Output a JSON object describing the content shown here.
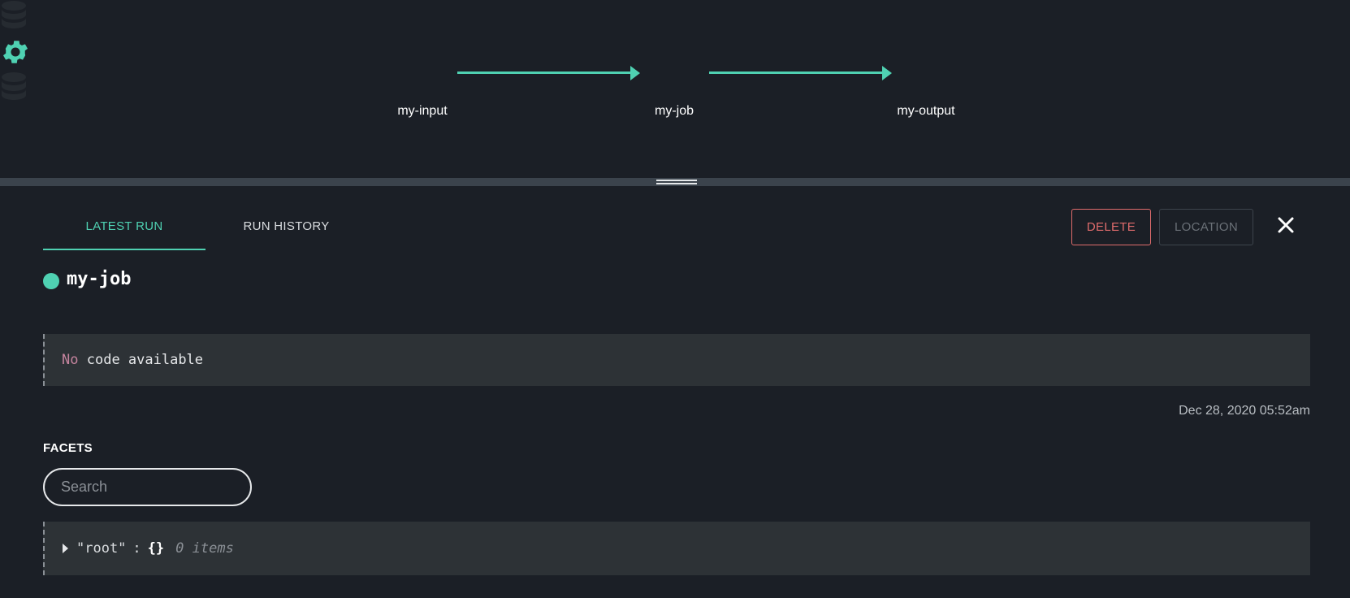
{
  "graph": {
    "nodes": [
      {
        "label": "my-input",
        "icon": "database-icon"
      },
      {
        "label": "my-job",
        "icon": "gear-icon"
      },
      {
        "label": "my-output",
        "icon": "database-icon"
      }
    ],
    "accent_color": "#4fd1b2"
  },
  "tabs": {
    "latest": "LATEST RUN",
    "history": "RUN HISTORY"
  },
  "actions": {
    "delete": "DELETE",
    "location": "LOCATION",
    "close_icon": "close-icon"
  },
  "job": {
    "name": "my-job",
    "status_color": "#4fd1b2"
  },
  "code": {
    "keyword": "No",
    "rest": "code available"
  },
  "run": {
    "timestamp": "Dec 28, 2020 05:52am"
  },
  "facets": {
    "heading": "FACETS",
    "search_placeholder": "Search",
    "root_key": "\"root\"",
    "colon": ":",
    "braces": "{}",
    "count": "0 items"
  }
}
